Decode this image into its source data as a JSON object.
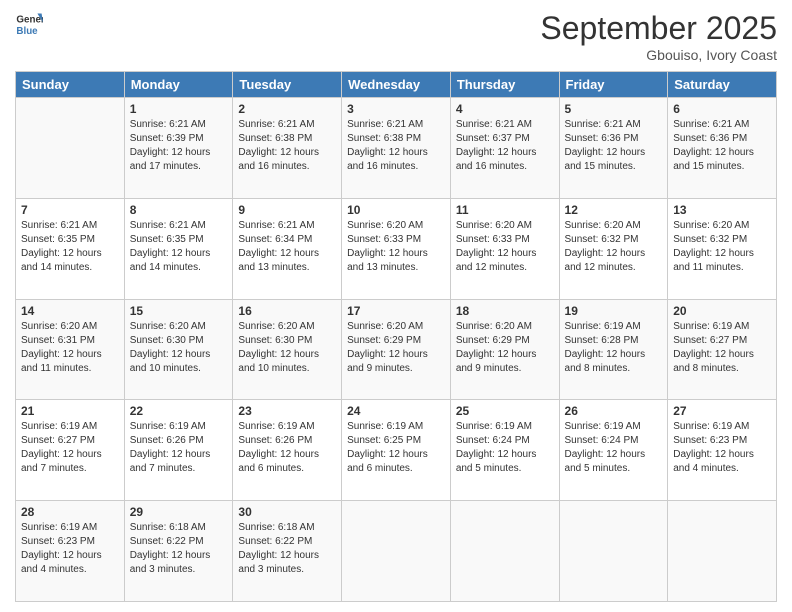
{
  "logo": {
    "line1": "General",
    "line2": "Blue"
  },
  "title": "September 2025",
  "subtitle": "Gbouiso, Ivory Coast",
  "days_of_week": [
    "Sunday",
    "Monday",
    "Tuesday",
    "Wednesday",
    "Thursday",
    "Friday",
    "Saturday"
  ],
  "weeks": [
    [
      {
        "day": "",
        "text": ""
      },
      {
        "day": "1",
        "text": "Sunrise: 6:21 AM\nSunset: 6:39 PM\nDaylight: 12 hours\nand 17 minutes."
      },
      {
        "day": "2",
        "text": "Sunrise: 6:21 AM\nSunset: 6:38 PM\nDaylight: 12 hours\nand 16 minutes."
      },
      {
        "day": "3",
        "text": "Sunrise: 6:21 AM\nSunset: 6:38 PM\nDaylight: 12 hours\nand 16 minutes."
      },
      {
        "day": "4",
        "text": "Sunrise: 6:21 AM\nSunset: 6:37 PM\nDaylight: 12 hours\nand 16 minutes."
      },
      {
        "day": "5",
        "text": "Sunrise: 6:21 AM\nSunset: 6:36 PM\nDaylight: 12 hours\nand 15 minutes."
      },
      {
        "day": "6",
        "text": "Sunrise: 6:21 AM\nSunset: 6:36 PM\nDaylight: 12 hours\nand 15 minutes."
      }
    ],
    [
      {
        "day": "7",
        "text": "Sunrise: 6:21 AM\nSunset: 6:35 PM\nDaylight: 12 hours\nand 14 minutes."
      },
      {
        "day": "8",
        "text": "Sunrise: 6:21 AM\nSunset: 6:35 PM\nDaylight: 12 hours\nand 14 minutes."
      },
      {
        "day": "9",
        "text": "Sunrise: 6:21 AM\nSunset: 6:34 PM\nDaylight: 12 hours\nand 13 minutes."
      },
      {
        "day": "10",
        "text": "Sunrise: 6:20 AM\nSunset: 6:33 PM\nDaylight: 12 hours\nand 13 minutes."
      },
      {
        "day": "11",
        "text": "Sunrise: 6:20 AM\nSunset: 6:33 PM\nDaylight: 12 hours\nand 12 minutes."
      },
      {
        "day": "12",
        "text": "Sunrise: 6:20 AM\nSunset: 6:32 PM\nDaylight: 12 hours\nand 12 minutes."
      },
      {
        "day": "13",
        "text": "Sunrise: 6:20 AM\nSunset: 6:32 PM\nDaylight: 12 hours\nand 11 minutes."
      }
    ],
    [
      {
        "day": "14",
        "text": "Sunrise: 6:20 AM\nSunset: 6:31 PM\nDaylight: 12 hours\nand 11 minutes."
      },
      {
        "day": "15",
        "text": "Sunrise: 6:20 AM\nSunset: 6:30 PM\nDaylight: 12 hours\nand 10 minutes."
      },
      {
        "day": "16",
        "text": "Sunrise: 6:20 AM\nSunset: 6:30 PM\nDaylight: 12 hours\nand 10 minutes."
      },
      {
        "day": "17",
        "text": "Sunrise: 6:20 AM\nSunset: 6:29 PM\nDaylight: 12 hours\nand 9 minutes."
      },
      {
        "day": "18",
        "text": "Sunrise: 6:20 AM\nSunset: 6:29 PM\nDaylight: 12 hours\nand 9 minutes."
      },
      {
        "day": "19",
        "text": "Sunrise: 6:19 AM\nSunset: 6:28 PM\nDaylight: 12 hours\nand 8 minutes."
      },
      {
        "day": "20",
        "text": "Sunrise: 6:19 AM\nSunset: 6:27 PM\nDaylight: 12 hours\nand 8 minutes."
      }
    ],
    [
      {
        "day": "21",
        "text": "Sunrise: 6:19 AM\nSunset: 6:27 PM\nDaylight: 12 hours\nand 7 minutes."
      },
      {
        "day": "22",
        "text": "Sunrise: 6:19 AM\nSunset: 6:26 PM\nDaylight: 12 hours\nand 7 minutes."
      },
      {
        "day": "23",
        "text": "Sunrise: 6:19 AM\nSunset: 6:26 PM\nDaylight: 12 hours\nand 6 minutes."
      },
      {
        "day": "24",
        "text": "Sunrise: 6:19 AM\nSunset: 6:25 PM\nDaylight: 12 hours\nand 6 minutes."
      },
      {
        "day": "25",
        "text": "Sunrise: 6:19 AM\nSunset: 6:24 PM\nDaylight: 12 hours\nand 5 minutes."
      },
      {
        "day": "26",
        "text": "Sunrise: 6:19 AM\nSunset: 6:24 PM\nDaylight: 12 hours\nand 5 minutes."
      },
      {
        "day": "27",
        "text": "Sunrise: 6:19 AM\nSunset: 6:23 PM\nDaylight: 12 hours\nand 4 minutes."
      }
    ],
    [
      {
        "day": "28",
        "text": "Sunrise: 6:19 AM\nSunset: 6:23 PM\nDaylight: 12 hours\nand 4 minutes."
      },
      {
        "day": "29",
        "text": "Sunrise: 6:18 AM\nSunset: 6:22 PM\nDaylight: 12 hours\nand 3 minutes."
      },
      {
        "day": "30",
        "text": "Sunrise: 6:18 AM\nSunset: 6:22 PM\nDaylight: 12 hours\nand 3 minutes."
      },
      {
        "day": "",
        "text": ""
      },
      {
        "day": "",
        "text": ""
      },
      {
        "day": "",
        "text": ""
      },
      {
        "day": "",
        "text": ""
      }
    ]
  ]
}
